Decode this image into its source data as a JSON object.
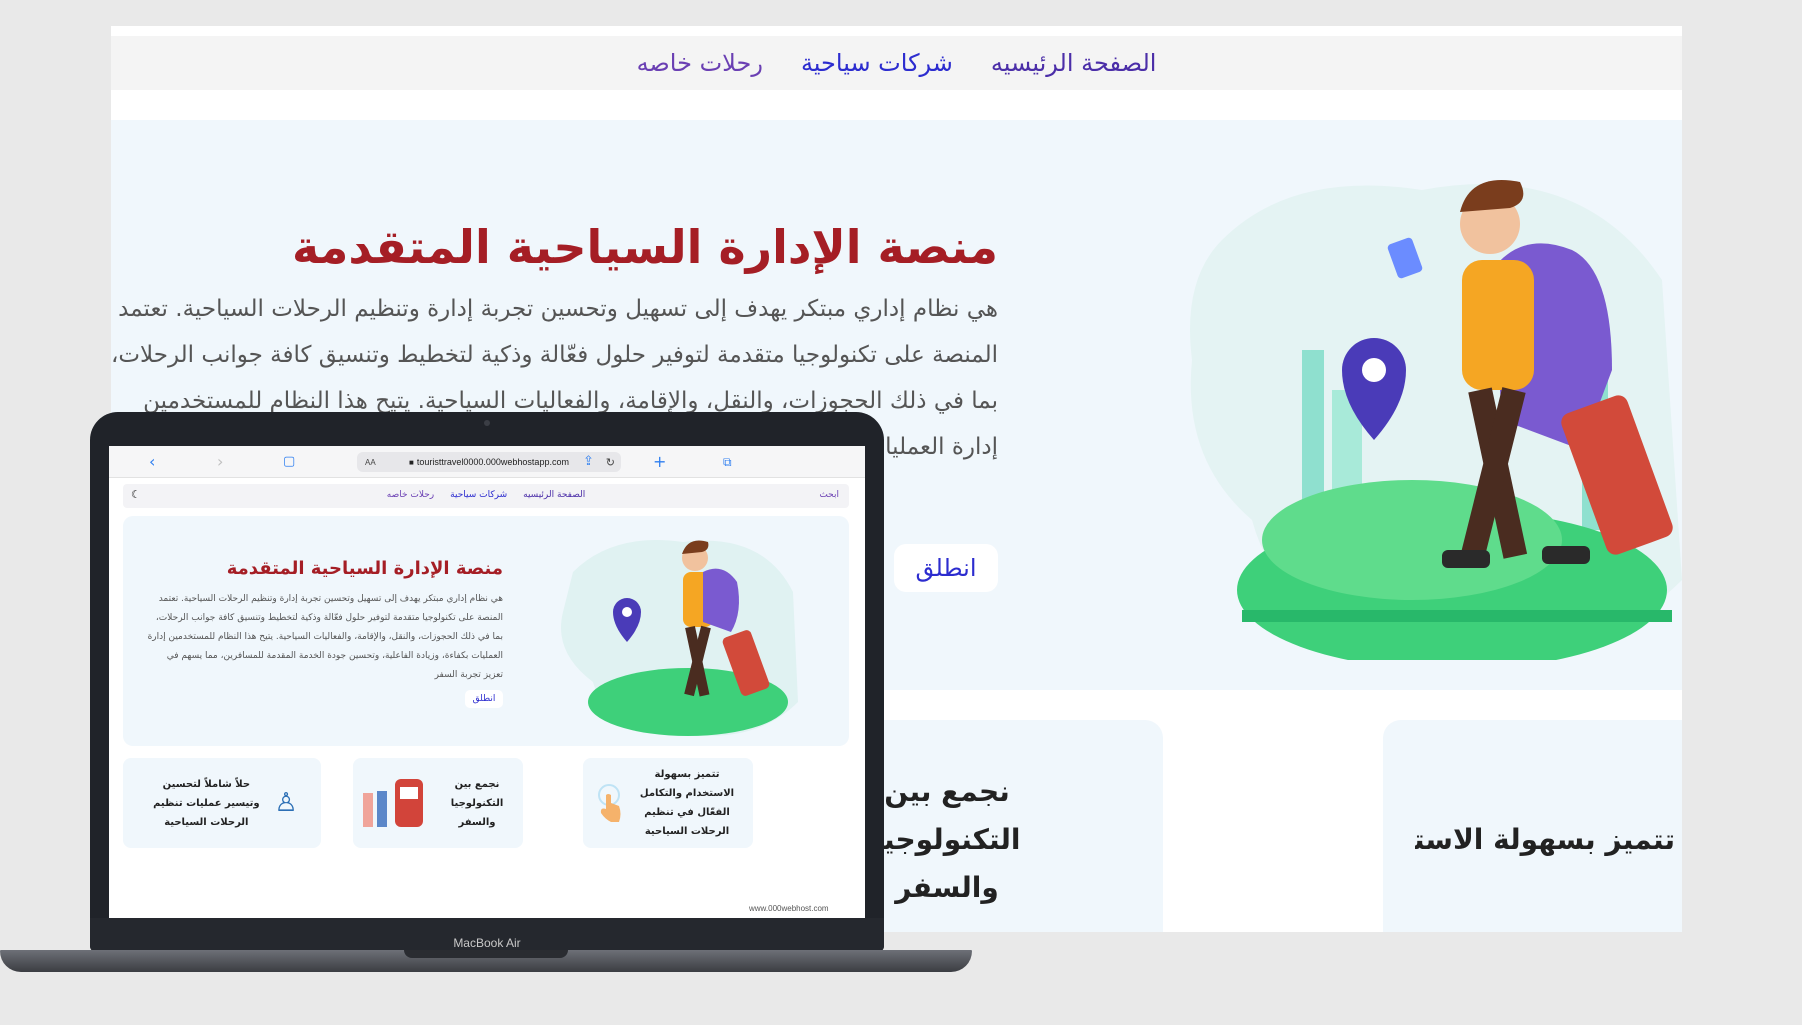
{
  "site": {
    "nav": {
      "home": "الصفحة الرئيسيه",
      "companies": "شركات سياحية",
      "special_trips": "رحلات خاصه"
    },
    "hero": {
      "title": "منصة الإدارة السياحية المتقدمة",
      "description": "هي نظام إداري مبتكر يهدف إلى تسهيل وتحسين تجربة إدارة وتنظيم الرحلات السياحية. تعتمد المنصة على تكنولوجيا متقدمة لتوفير حلول فعّالة وذكية لتخطيط وتنسيق كافة جوانب الرحلات، بما في ذلك الحجوزات، والنقل، والإقامة، والفعاليات السياحية. يتيح هذا النظام للمستخدمين إدارة العمليات بكفاءة، وزيادة الفاعلية، وتحسين جودة الخدمة المقدمة للمسافرين.",
      "cta": "انطلق"
    },
    "cards": {
      "tech_travel": "نجمع بين التكنولوجيا والسفر",
      "ease_of_use": "تتميز بسهولة الاستخدام والتكامل الفعّال في تنظيم الرحلات السياحية"
    }
  },
  "laptop": {
    "label": "MacBook Air",
    "browser": {
      "text_size": "AA",
      "url": "touristtravel0000.000webhostapp.com"
    },
    "inner": {
      "search": "ابحث",
      "nav": {
        "home": "الصفحة الرئيسيه",
        "companies": "شركات سياحية",
        "special_trips": "رحلات خاصه"
      },
      "hero": {
        "title": "منصة الإدارة السياحية المتقدمة",
        "description": "هي نظام إداري مبتكر يهدف إلى تسهيل وتحسين تجربة إدارة وتنظيم الرحلات السياحية. تعتمد المنصة على تكنولوجيا متقدمة لتوفير حلول فعّالة وذكية لتخطيط وتنسيق كافة جوانب الرحلات، بما في ذلك الحجوزات، والنقل، والإقامة، والفعاليات السياحية. يتيح هذا النظام للمستخدمين إدارة العمليات بكفاءة، وزيادة الفاعلية، وتحسين جودة الخدمة المقدمة للمسافرين، مما يسهم في تعزيز تجربة السفر",
        "cta": "انطلق"
      },
      "cards": [
        {
          "text": "حلاً شاملاً لتحسين وتيسير عمليات تنظيم الرحلات السياحية",
          "icon": "business-person-icon"
        },
        {
          "text": "نجمع بين التكنولوجيا والسفر",
          "icon": "train-travelers-icon"
        },
        {
          "text": "تتميز بسهولة الاستخدام والتكامل الفعّال في تنظيم الرحلات السياحية",
          "icon": "touch-hand-icon"
        }
      ],
      "footer_link": "www.000webhost.com"
    }
  },
  "colors": {
    "title": "#a51e25",
    "link": "#2c2ccf",
    "nav": "#4b2ea8",
    "hero_bg": "#f0f7fc"
  }
}
